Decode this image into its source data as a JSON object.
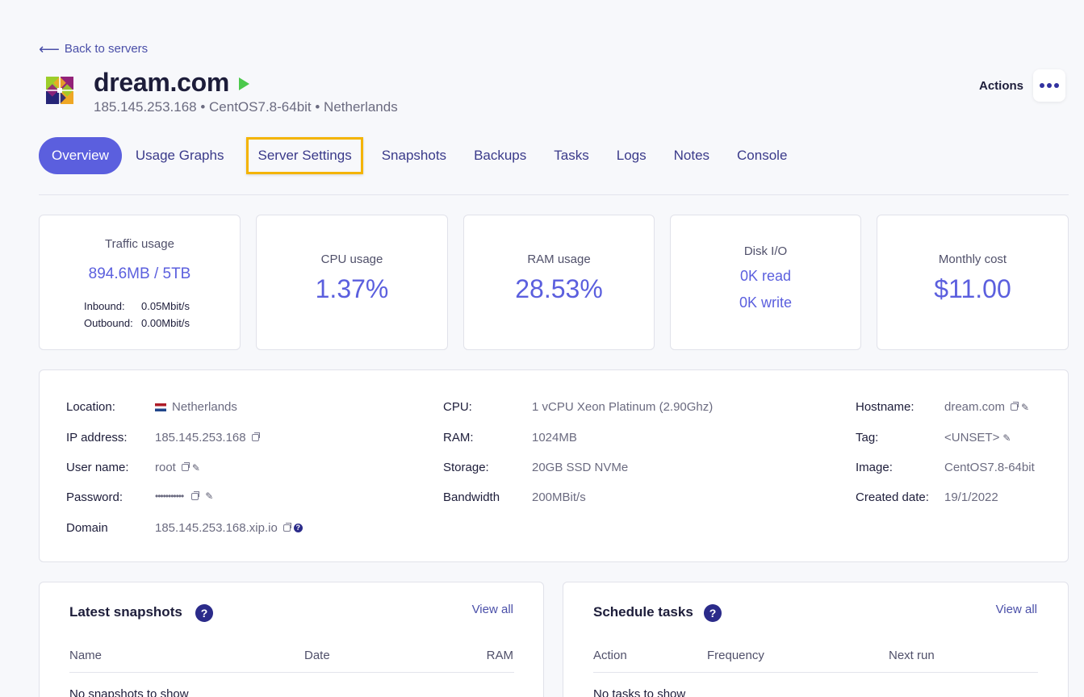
{
  "nav": {
    "back_label": "Back to servers",
    "back_icon": "arrow-left-icon"
  },
  "server": {
    "name": "dream.com",
    "subtitle": "185.145.253.168 • CentOS7.8-64bit • Netherlands",
    "status_color": "#4cc94c"
  },
  "actions": {
    "label": "Actions"
  },
  "tabs": [
    {
      "label": "Overview",
      "active": true
    },
    {
      "label": "Usage Graphs"
    },
    {
      "label": "Server Settings",
      "highlighted": true
    },
    {
      "label": "Snapshots"
    },
    {
      "label": "Backups"
    },
    {
      "label": "Tasks"
    },
    {
      "label": "Logs"
    },
    {
      "label": "Notes"
    },
    {
      "label": "Console"
    }
  ],
  "stats": {
    "traffic": {
      "label": "Traffic usage",
      "value": "894.6MB / 5TB",
      "inbound_label": "Inbound:",
      "inbound_value": "0.05Mbit/s",
      "outbound_label": "Outbound:",
      "outbound_value": "0.00Mbit/s"
    },
    "cpu": {
      "label": "CPU usage",
      "value": "1.37%"
    },
    "ram": {
      "label": "RAM usage",
      "value": "28.53%"
    },
    "disk": {
      "label": "Disk I/O",
      "read": "0K read",
      "write": "0K write"
    },
    "cost": {
      "label": "Monthly cost",
      "value": "$11.00"
    }
  },
  "info": {
    "location_label": "Location:",
    "location_value": "Netherlands",
    "ip_label": "IP address:",
    "ip_value": "185.145.253.168",
    "user_label": "User name:",
    "user_value": "root",
    "password_label": "Password:",
    "password_value": "•••••••••••",
    "domain_label": "Domain",
    "domain_value": "185.145.253.168.xip.io",
    "cpu_label": "CPU:",
    "cpu_value": "1 vCPU Xeon Platinum (2.90Ghz)",
    "ram_label": "RAM:",
    "ram_value": "1024MB",
    "storage_label": "Storage:",
    "storage_value": "20GB SSD NVMe",
    "bandwidth_label": "Bandwidth",
    "bandwidth_value": "200MBit/s",
    "hostname_label": "Hostname:",
    "hostname_value": "dream.com",
    "tag_label": "Tag:",
    "tag_value": "<UNSET>",
    "image_label": "Image:",
    "image_value": "CentOS7.8-64bit",
    "created_label": "Created date:",
    "created_value": "19/1/2022"
  },
  "snapshots": {
    "title": "Latest snapshots",
    "view_all": "View all",
    "col_name": "Name",
    "col_date": "Date",
    "col_ram": "RAM",
    "empty": "No snapshots to show"
  },
  "tasks": {
    "title": "Schedule tasks",
    "view_all": "View all",
    "col_action": "Action",
    "col_frequency": "Frequency",
    "col_next": "Next run",
    "empty": "No tasks to show"
  },
  "help_glyph": "?",
  "colors": {
    "accent": "#5b5fde",
    "highlight_border": "#f4b400",
    "dark_blue": "#2b2b8a"
  }
}
